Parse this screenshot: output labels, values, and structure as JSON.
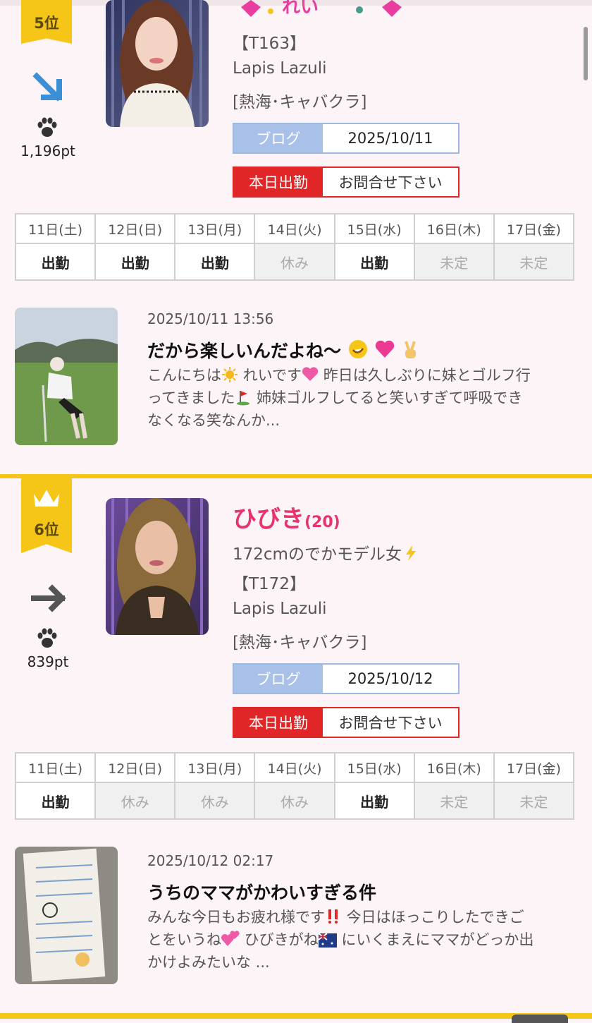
{
  "cards": [
    {
      "rank": "5位",
      "trend": "down-right-arrow",
      "points": "1,196pt",
      "height_label": "【T163】",
      "shop": "Lapis Lazuli",
      "area": "[熱海･キャバクラ]",
      "blog_label": "ブログ",
      "blog_date": "2025/10/11",
      "shift_label": "本日出勤",
      "shift_value": "お問合せ下さい",
      "days": [
        "11日(土)",
        "12日(日)",
        "13日(月)",
        "14日(火)",
        "15日(水)",
        "16日(木)",
        "17日(金)"
      ],
      "status": [
        "出勤",
        "出勤",
        "出勤",
        "休み",
        "出勤",
        "未定",
        "未定"
      ],
      "post": {
        "date": "2025/10/11 13:56",
        "title": "だから楽しいんだよね〜",
        "body_line1a": "こんにちは",
        "body_line1b": " れいです",
        "body_line1c": " 昨日は久しぶりに妹とゴルフ行",
        "body_line2a": "ってきました",
        "body_line2b": " 姉妹ゴルフしてると笑いすぎて呼吸でき",
        "body_line3": "なくなる笑なんか..."
      }
    },
    {
      "rank": "6位",
      "trend": "right-arrow",
      "points": "839pt",
      "name": "ひびき",
      "age": "(20)",
      "catch": "172cmのでかモデル女",
      "height_label": "【T172】",
      "shop": "Lapis Lazuli",
      "area": "[熱海･キャバクラ]",
      "blog_label": "ブログ",
      "blog_date": "2025/10/12",
      "shift_label": "本日出勤",
      "shift_value": "お問合せ下さい",
      "days": [
        "11日(土)",
        "12日(日)",
        "13日(月)",
        "14日(火)",
        "15日(水)",
        "16日(木)",
        "17日(金)"
      ],
      "status": [
        "出勤",
        "休み",
        "休み",
        "休み",
        "出勤",
        "未定",
        "未定"
      ],
      "post": {
        "date": "2025/10/12 02:17",
        "title": "うちのママがかわいすぎる件",
        "body_line1a": "みんな今日もお疲れ様です",
        "body_line1b": " 今日はほっこりしたできご",
        "body_line2a": "とをいうね",
        "body_line2b": " ひびきがね",
        "body_line2c": " にいくまえにママがどっか出",
        "body_line3": "かけよみたいな ..."
      }
    }
  ],
  "colors": {
    "accent_yellow": "#f5c518",
    "name_pink": "#e8336d",
    "shift_red": "#e02626",
    "blog_blue": "#a9c1e8"
  }
}
